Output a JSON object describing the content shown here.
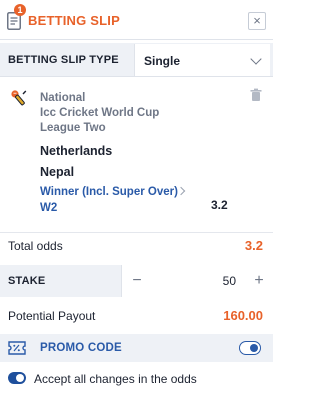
{
  "header": {
    "title": "BETTING SLIP",
    "badge_count": "1",
    "close_label": "×",
    "icon": "slip-icon"
  },
  "slip_type": {
    "label": "BETTING SLIP TYPE",
    "value": "Single"
  },
  "bet": {
    "sport_icon": "cricket-icon",
    "competition_line1": "National",
    "competition_line2": "Icc Cricket World Cup",
    "competition_line3": "League Two",
    "team_home": "Netherlands",
    "team_away": "Nepal",
    "market": "Winner (Incl. Super Over)",
    "selection": "W2",
    "odds": "3.2"
  },
  "totals": {
    "total_odds_label": "Total odds",
    "total_odds_value": "3.2"
  },
  "stake": {
    "label": "STAKE",
    "minus": "−",
    "value": "50",
    "plus": "+"
  },
  "payout": {
    "label": "Potential Payout",
    "value": "160.00"
  },
  "promo": {
    "label": "PROMO CODE",
    "enabled": false
  },
  "accept_changes": {
    "label": "Accept all changes in the odds",
    "enabled": true
  },
  "colors": {
    "accent": "#e8622a",
    "link": "#2a5aa8",
    "panel_bg": "#eef1f6"
  }
}
